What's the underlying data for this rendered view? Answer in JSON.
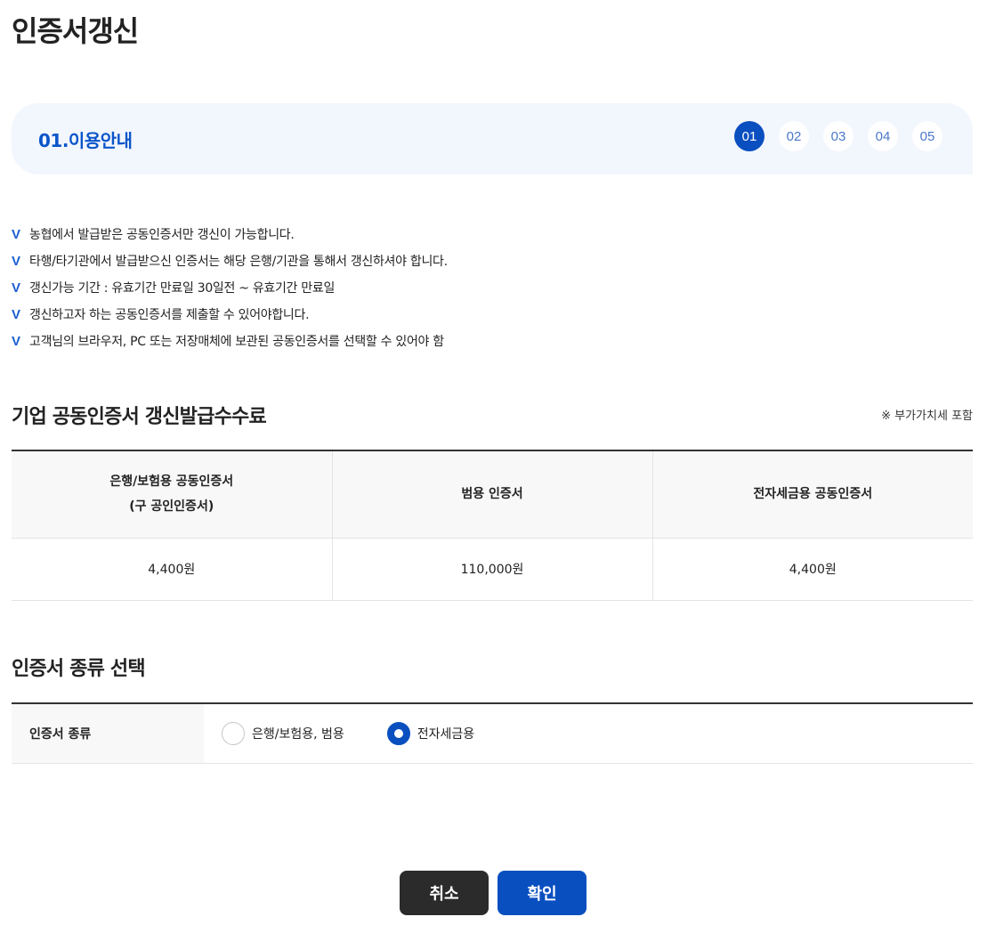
{
  "page_title": "인증서갱신",
  "steps": {
    "current_title": "01.이용안내",
    "items": [
      "01",
      "02",
      "03",
      "04",
      "05"
    ],
    "active_index": 0
  },
  "notices": [
    "농협에서 발급받은 공동인증서만 갱신이 가능합니다.",
    "타행/타기관에서 발급받으신 인증서는 해당 은행/기관을 통해서 갱신하셔야 합니다.",
    "갱신가능 기간 : 유효기간 만료일 30일전 ~ 유효기간 만료일",
    "갱신하고자 하는 공동인증서를 제출할 수 있어야합니다.",
    "고객님의 브라우저, PC 또는 저장매체에 보관된 공동인증서를 선택할 수 있어야 함"
  ],
  "check_mark": "V",
  "fee_section": {
    "title": "기업 공동인증서 갱신발급수수료",
    "note": "※ 부가가치세 포함",
    "headers": [
      {
        "line1": "은행/보험용 공동인증서",
        "line2": "(구 공인인증서)"
      },
      {
        "line1": "범용 인증서",
        "line2": ""
      },
      {
        "line1": "전자세금용 공동인증서",
        "line2": ""
      }
    ],
    "values": [
      "4,400원",
      "110,000원",
      "4,400원"
    ]
  },
  "type_section": {
    "title": "인증서 종류 선택",
    "label": "인증서 종류",
    "options": [
      {
        "label": "은행/보험용, 범용",
        "checked": false
      },
      {
        "label": "전자세금용",
        "checked": true
      }
    ]
  },
  "buttons": {
    "cancel": "취소",
    "confirm": "확인"
  },
  "colors": {
    "accent": "#0a4fc0",
    "step_bg": "#f2f6fd",
    "cancel_bg": "#2b2b2b"
  }
}
